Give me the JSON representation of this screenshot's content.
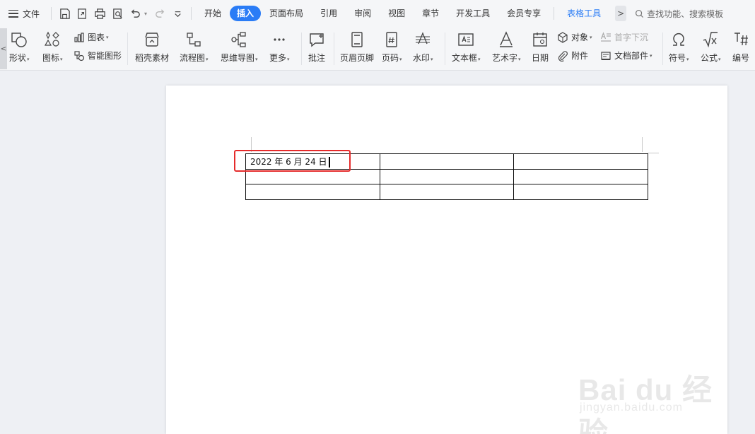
{
  "menubar": {
    "file_label": "文件",
    "tabs": [
      {
        "label": "开始"
      },
      {
        "label": "插入"
      },
      {
        "label": "页面布局"
      },
      {
        "label": "引用"
      },
      {
        "label": "审阅"
      },
      {
        "label": "视图"
      },
      {
        "label": "章节"
      },
      {
        "label": "开发工具"
      },
      {
        "label": "会员专享"
      },
      {
        "label": "表格工具"
      }
    ],
    "active_tab": "插入",
    "more_arrow": ">",
    "search_label": "查找功能、搜索模板"
  },
  "ribbon": {
    "collapse_arrow": "<",
    "shape": "形状",
    "icon": "图标",
    "chart": "图表",
    "smart_graphic": "智能图形",
    "rice_material": "稻壳素材",
    "flowchart": "流程图",
    "mindmap": "思维导图",
    "more": "更多",
    "comment": "批注",
    "header_footer": "页眉页脚",
    "page_number": "页码",
    "watermark": "水印",
    "textbox": "文本框",
    "wordart": "艺术字",
    "date": "日期",
    "object": "对象",
    "attachment": "附件",
    "drop_cap": "首字下沉",
    "doc_parts": "文档部件",
    "symbol": "符号",
    "formula": "公式",
    "numbering": "编号",
    "dropdown_glyph": "▾"
  },
  "document": {
    "table": {
      "rows": [
        [
          "2022 年 6 月 24 日",
          "",
          ""
        ],
        [
          "",
          "",
          ""
        ],
        [
          "",
          "",
          ""
        ]
      ]
    }
  },
  "watermark": {
    "brand": "Bai du 经验",
    "url": "jingyan.baidu.com"
  },
  "colors": {
    "accent": "#2a7cf6",
    "highlight_box": "#e52b2b"
  }
}
